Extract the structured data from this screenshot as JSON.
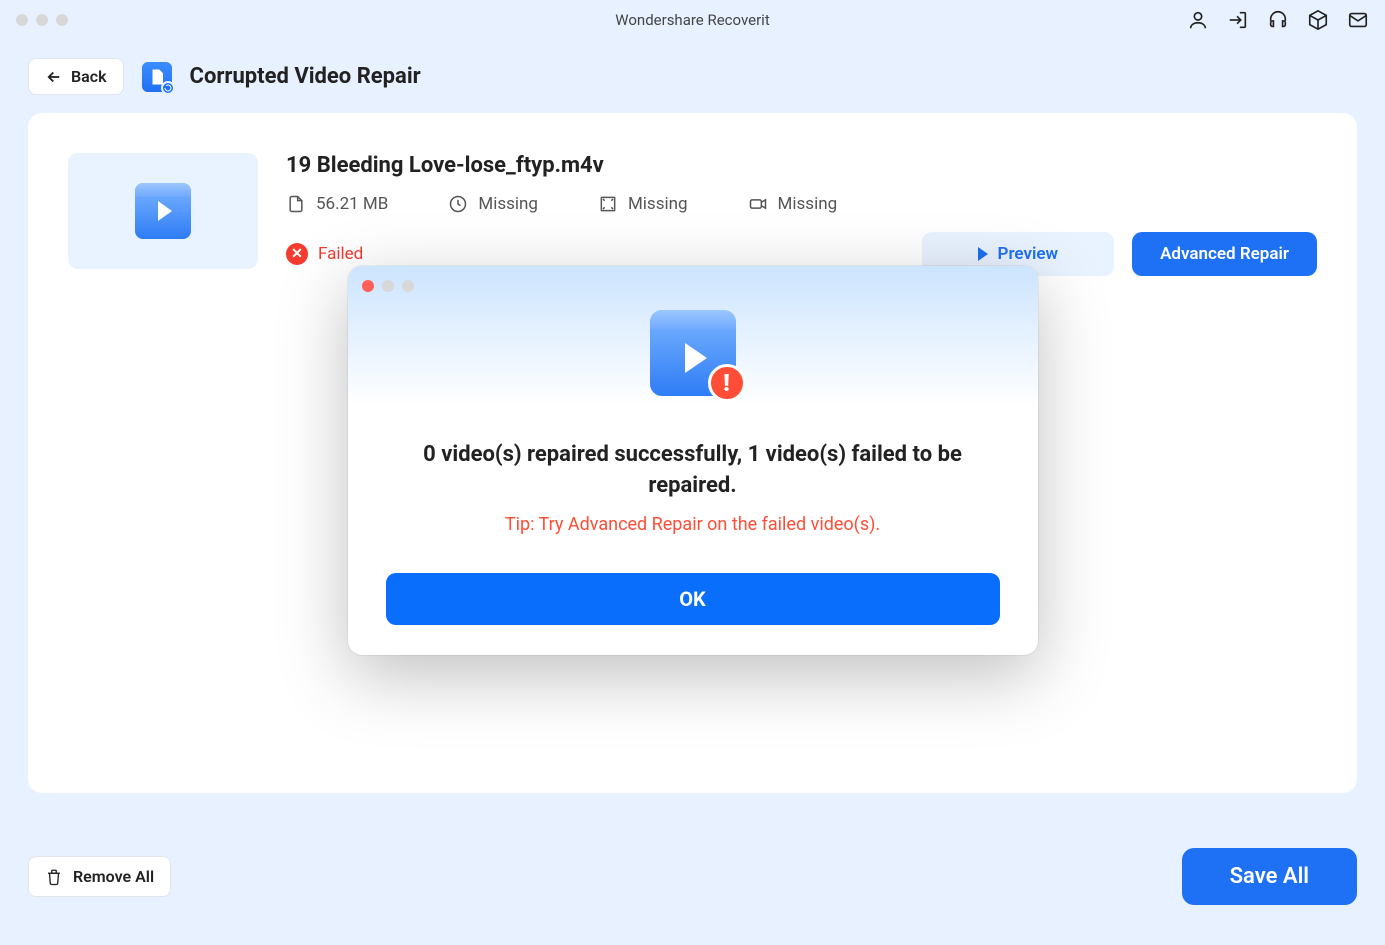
{
  "window": {
    "title": "Wondershare Recoverit"
  },
  "header": {
    "back_label": "Back",
    "page_title": "Corrupted Video Repair"
  },
  "file": {
    "name": "19 Bleeding Love-lose_ftyp.m4v",
    "size": "56.21 MB",
    "duration": "Missing",
    "resolution": "Missing",
    "camera": "Missing",
    "status": "Failed",
    "preview_label": "Preview",
    "advanced_repair_label": "Advanced Repair"
  },
  "footer": {
    "remove_all_label": "Remove All",
    "save_all_label": "Save All"
  },
  "modal": {
    "message": "0 video(s) repaired successfully, 1 video(s) failed to be repaired.",
    "tip": "Tip: Try Advanced Repair on the failed video(s).",
    "ok_label": "OK"
  }
}
